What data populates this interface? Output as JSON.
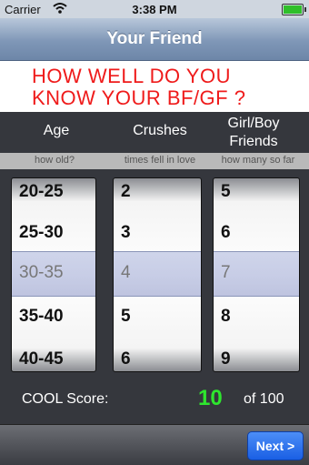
{
  "status": {
    "carrier": "Carrier",
    "time": "3:38 PM"
  },
  "nav": {
    "title": "Your Friend"
  },
  "headline": {
    "line1": "HOW WELL DO YOU",
    "line2": "KNOW YOUR BF/GF ?"
  },
  "columns": [
    {
      "title": "Age",
      "subtitle": "how old?",
      "rows": [
        "20-25",
        "25-30",
        "30-35",
        "35-40",
        "40-45"
      ],
      "selected": "30-35"
    },
    {
      "title": "Crushes",
      "subtitle": "times fell in love",
      "rows": [
        "2",
        "3",
        "4",
        "5",
        "6"
      ],
      "selected": "4"
    },
    {
      "title_line1": "Girl/Boy",
      "title_line2": "Friends",
      "subtitle": "how many so far",
      "rows": [
        "5",
        "6",
        "7",
        "8",
        "9"
      ],
      "selected": "7"
    }
  ],
  "score": {
    "label": "COOL Score:",
    "value": "10",
    "suffix": "of 100"
  },
  "buttons": {
    "next": "Next >"
  },
  "colors": {
    "score_value": "#2ee62e",
    "headline": "#ef1b1b",
    "next_button": "#1a5fe4"
  }
}
